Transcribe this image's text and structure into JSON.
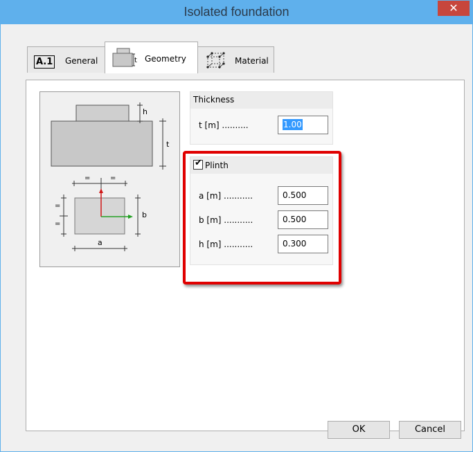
{
  "window": {
    "title": "Isolated foundation",
    "close_glyph": "✕"
  },
  "tabs": [
    {
      "label": "General",
      "badge": "A.1"
    },
    {
      "label": "Geometry"
    },
    {
      "label": "Material"
    }
  ],
  "sketch": {
    "label_h": "h",
    "label_t": "t",
    "label_b": "b",
    "label_a": "a",
    "eq": "="
  },
  "thickness": {
    "title": "Thickness",
    "label": "t [m] ..........",
    "value": "1.00"
  },
  "plinth": {
    "title": "Plinth",
    "checked": true,
    "rows": [
      {
        "label": "a [m] ...........",
        "value": "0.500"
      },
      {
        "label": "b [m] ...........",
        "value": "0.500"
      },
      {
        "label": "h [m] ...........",
        "value": "0.300"
      }
    ]
  },
  "buttons": {
    "ok": "OK",
    "cancel": "Cancel"
  }
}
